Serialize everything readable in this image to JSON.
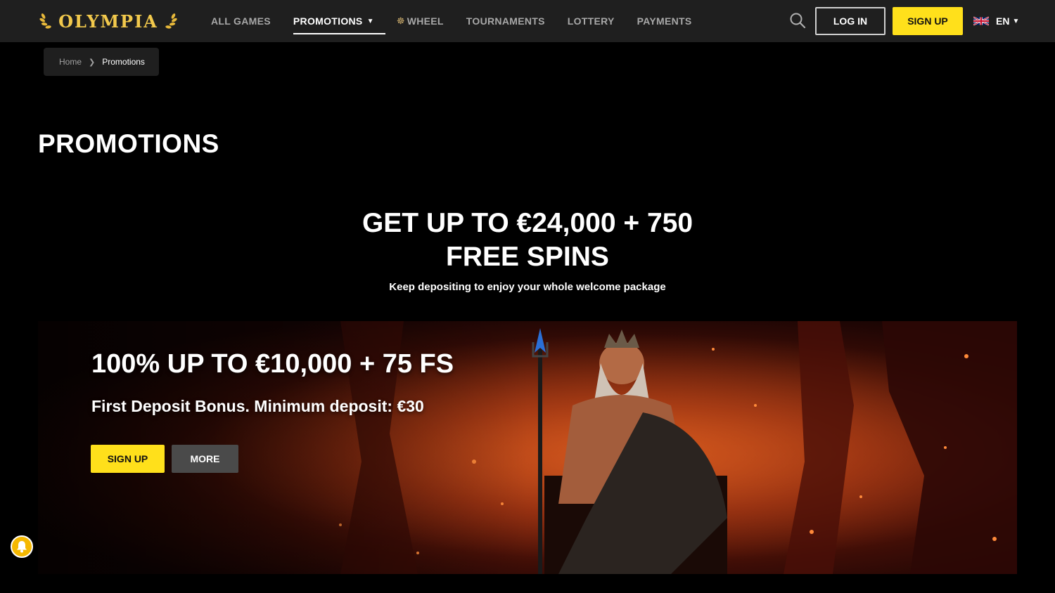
{
  "brand": {
    "name": "OLYMPIA",
    "accent": "#ffe01b",
    "gold": "#f2c94c"
  },
  "nav": {
    "items": [
      {
        "label": "ALL GAMES"
      },
      {
        "label": "PROMOTIONS"
      },
      {
        "label": "WHEEL"
      },
      {
        "label": "TOURNAMENTS"
      },
      {
        "label": "LOTTERY"
      },
      {
        "label": "PAYMENTS"
      }
    ],
    "active": "PROMOTIONS"
  },
  "header": {
    "login_label": "LOG IN",
    "signup_label": "SIGN UP",
    "language": "EN"
  },
  "breadcrumb": {
    "home": "Home",
    "current": "Promotions"
  },
  "page": {
    "title": "PROMOTIONS"
  },
  "hero": {
    "line1": "GET UP TO €24,000 + 750",
    "line2": "FREE SPINS",
    "subtitle": "Keep depositing to enjoy your whole welcome package"
  },
  "banner": {
    "title": "100% UP TO €10,000 + 75 FS",
    "subtitle": "First Deposit Bonus. Minimum deposit: €30",
    "signup_label": "SIGN UP",
    "more_label": "MORE"
  },
  "icons": [
    "laurel-icon",
    "wheel-icon",
    "chevron-down-icon",
    "search-icon",
    "uk-flag-icon",
    "chevron-right-icon",
    "bell-icon"
  ]
}
